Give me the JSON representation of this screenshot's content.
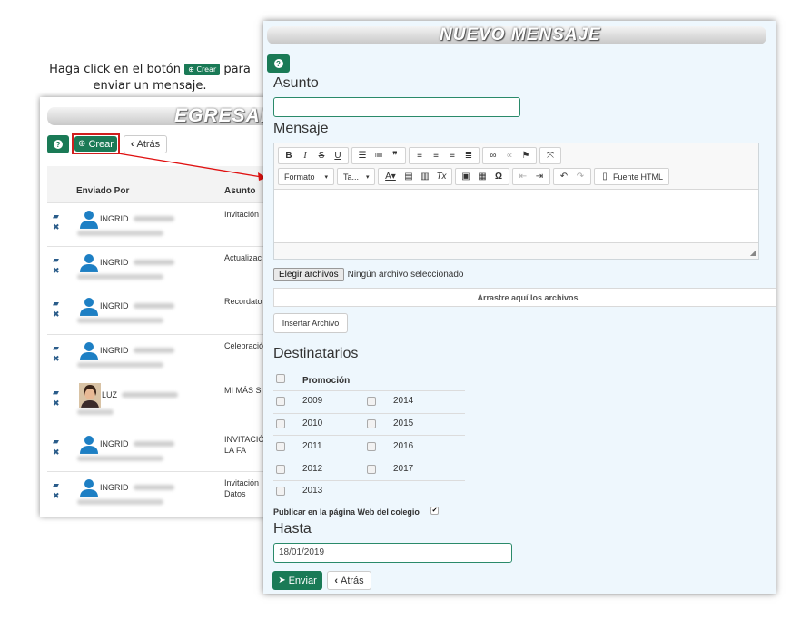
{
  "instruction": {
    "line1_pre": "Haga click en el botón",
    "mini_button": "Crear",
    "line1_post": "para",
    "line2": "enviar un mensaje."
  },
  "back_window": {
    "banner": "EGRESADOS",
    "help_icon": "question-circle-icon",
    "crear_label": "Crear",
    "atras_label": "Atrás",
    "columns": [
      "Enviado Por",
      "Asunto"
    ],
    "rows": [
      {
        "name": "INGRID",
        "subject": "Invitación",
        "avatar": "user-icon"
      },
      {
        "name": "INGRID",
        "subject": "Actualizac",
        "avatar": "user-icon"
      },
      {
        "name": "INGRID",
        "subject": "Recordato",
        "avatar": "user-icon"
      },
      {
        "name": "INGRID",
        "subject": "Celebració",
        "avatar": "user-icon"
      },
      {
        "name": "LUZ",
        "subject": "MI MÁS S",
        "avatar": "photo"
      },
      {
        "name": "INGRID",
        "subject": "INVITACIÓ DE LA FA",
        "avatar": "user-icon"
      },
      {
        "name": "INGRID",
        "subject": "Invitación Datos",
        "avatar": "user-icon"
      }
    ]
  },
  "front_window": {
    "banner": "NUEVO MENSAJE",
    "asunto_label": "Asunto",
    "asunto_value": "",
    "mensaje_label": "Mensaje",
    "toolbar": {
      "formato": "Formato",
      "tamano": "Ta...",
      "fuente_html": "Fuente HTML"
    },
    "file_button": "Elegir archivos",
    "file_status": "Ningún archivo seleccionado",
    "dropzone": "Arrastre aquí los archivos",
    "insertar_archivo": "Insertar Archivo",
    "destinatarios_label": "Destinatarios",
    "promocion_header": "Promoción",
    "years_left": [
      "2009",
      "2010",
      "2011",
      "2012",
      "2013"
    ],
    "years_right": [
      "2014",
      "2015",
      "2016",
      "2017"
    ],
    "publicar_label": "Publicar en la página Web del colegio",
    "hasta_label": "Hasta",
    "hasta_value": "18/01/2019",
    "enviar_label": "Enviar",
    "atras_label": "Atrás"
  },
  "colors": {
    "accent_green": "#1a7a56",
    "highlight_red": "#d01e1e",
    "panel_bg": "#eef7fd"
  }
}
